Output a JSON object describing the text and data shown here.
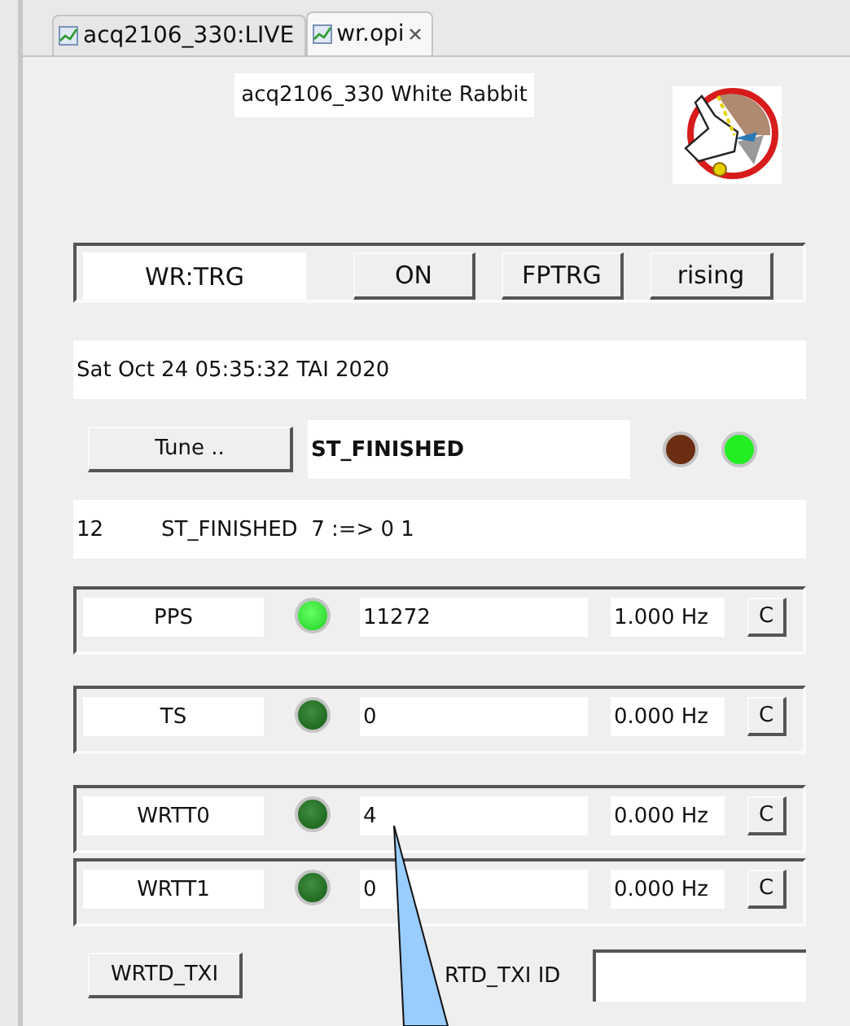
{
  "tabs": [
    {
      "label": "acq2106_330:LIVE",
      "selected": false
    },
    {
      "label": "wr.opi",
      "selected": true
    }
  ],
  "title": "acq2106_330 White Rabbit",
  "trigger": {
    "name": "WR:TRG",
    "buttons": [
      "ON",
      "FPTRG",
      "rising"
    ]
  },
  "date": "Sat Oct 24 05:35:32 TAI 2020",
  "tune": {
    "button": "Tune ..",
    "state": "ST_FINISHED",
    "leds": [
      {
        "color": "#6b2e12"
      },
      {
        "color": "#22ee22"
      }
    ]
  },
  "status": {
    "code": "12",
    "text": "ST_FINISHED  7 :=> 0 1"
  },
  "counters": [
    {
      "name": "PPS",
      "on": true,
      "value": "11272",
      "rate": "1.000 Hz",
      "button": "C"
    },
    {
      "name": "TS",
      "on": false,
      "value": "0",
      "rate": "0.000 Hz",
      "button": "C"
    },
    {
      "name": "WRTT0",
      "on": false,
      "value": "4",
      "rate": "0.000 Hz",
      "button": "C"
    },
    {
      "name": "WRTT1",
      "on": false,
      "value": "0",
      "rate": "0.000 Hz",
      "button": "C"
    }
  ],
  "txi": {
    "button": "WRTD_TXI",
    "label": "RTD_TXI ID"
  }
}
